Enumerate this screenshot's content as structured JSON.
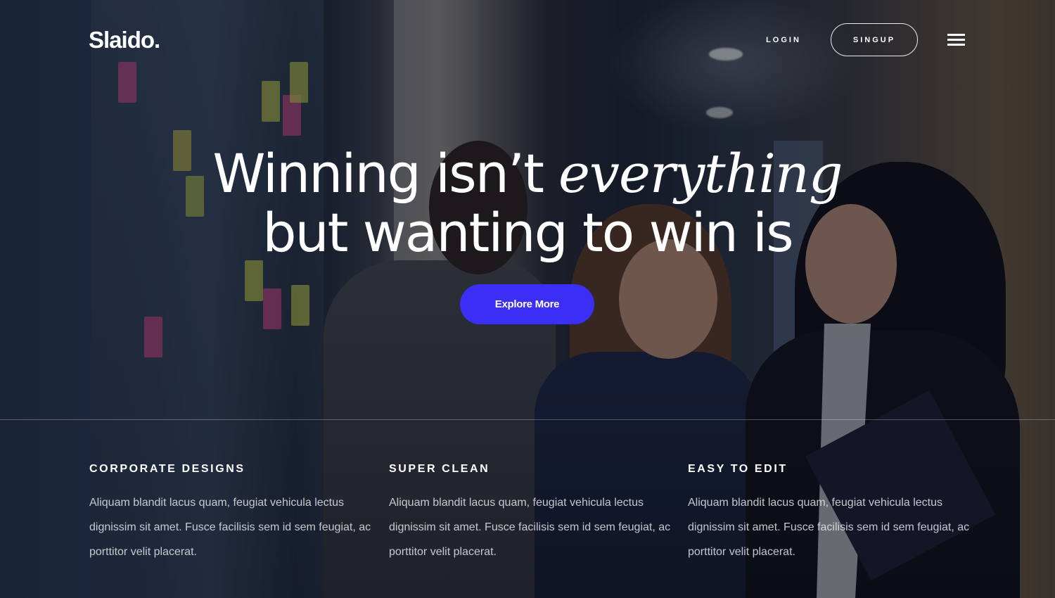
{
  "header": {
    "logo": "Slaido.",
    "login_label": "LOGIN",
    "signup_label": "SINGUP",
    "menu_icon": "hamburger-menu-icon"
  },
  "hero": {
    "headline_line1_plain": "Winning isn’t ",
    "headline_line1_italic": "everything",
    "headline_line2": "but wanting to win is",
    "cta_label": "Explore More",
    "background": "photo of three business people talking in an office corridor"
  },
  "features": [
    {
      "title": "CORPORATE DESIGNS",
      "text": "Aliquam blandit lacus quam, feugiat vehicula lectus dignissim sit amet. Fusce facilisis sem id sem feugiat, ac porttitor velit placerat."
    },
    {
      "title": "SUPER CLEAN",
      "text": "Aliquam blandit lacus quam, feugiat vehicula lectus dignissim sit amet. Fusce facilisis sem id sem feugiat, ac porttitor velit placerat."
    },
    {
      "title": "EASY TO EDIT",
      "text": "Aliquam blandit lacus quam, feugiat vehicula lectus dignissim sit amet. Fusce facilisis sem id sem feugiat, ac porttitor velit placerat."
    }
  ],
  "colors": {
    "accent": "#3b2ff5",
    "text": "#ffffff",
    "overlay": "#0a0e1c"
  }
}
